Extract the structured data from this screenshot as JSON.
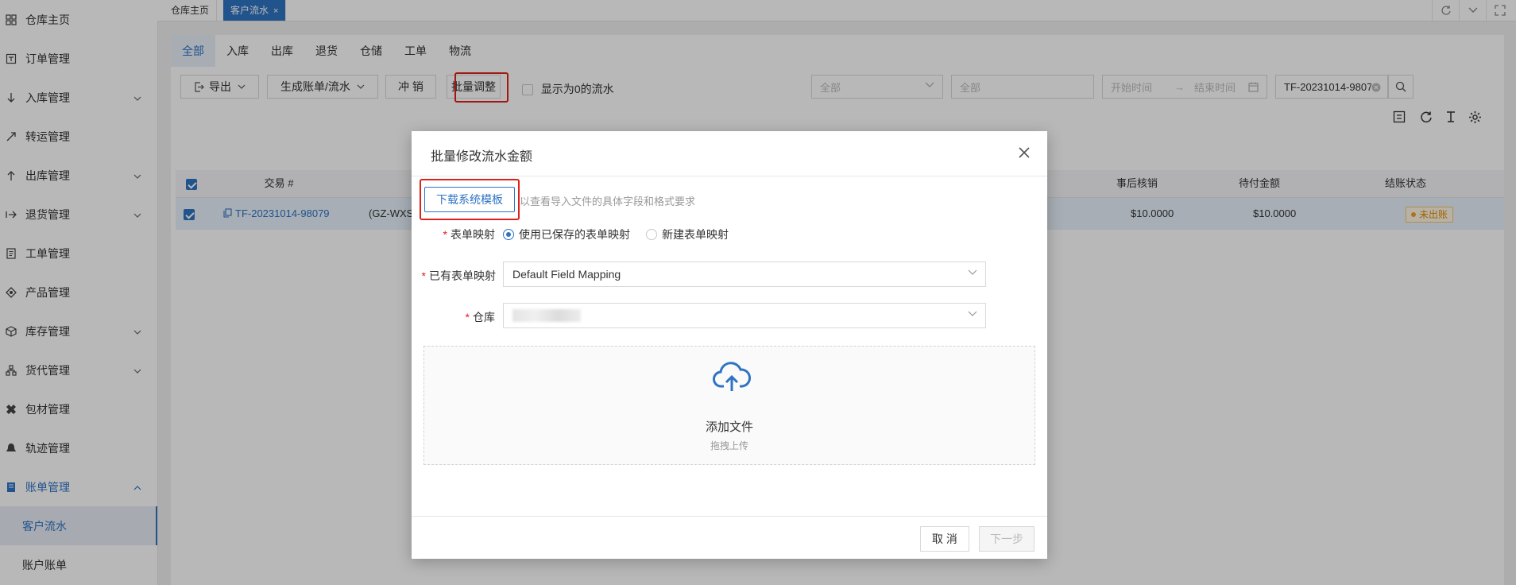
{
  "sidebar": {
    "items": [
      {
        "label": "仓库主页",
        "icon": "grid-icon",
        "chevron": false
      },
      {
        "label": "订单管理",
        "icon": "order-icon",
        "chevron": false
      },
      {
        "label": "入库管理",
        "icon": "inbound-icon",
        "chevron": true
      },
      {
        "label": "转运管理",
        "icon": "transfer-icon",
        "chevron": false
      },
      {
        "label": "出库管理",
        "icon": "outbound-icon",
        "chevron": true
      },
      {
        "label": "退货管理",
        "icon": "return-icon",
        "chevron": true
      },
      {
        "label": "工单管理",
        "icon": "ticket-icon",
        "chevron": false
      },
      {
        "label": "产品管理",
        "icon": "product-icon",
        "chevron": false
      },
      {
        "label": "库存管理",
        "icon": "inventory-icon",
        "chevron": true
      },
      {
        "label": "货代管理",
        "icon": "forwarder-icon",
        "chevron": true
      },
      {
        "label": "包材管理",
        "icon": "package-icon",
        "chevron": false
      },
      {
        "label": "轨迹管理",
        "icon": "track-icon",
        "chevron": false
      },
      {
        "label": "账单管理",
        "icon": "bill-icon",
        "chevron": true
      }
    ],
    "sub_items": [
      {
        "label": "客户流水"
      },
      {
        "label": "账户账单"
      }
    ]
  },
  "tabs": {
    "home": "仓库主页",
    "active": "客户流水",
    "close": "×"
  },
  "filter_tabs": [
    "全部",
    "入库",
    "出库",
    "退货",
    "仓储",
    "工单",
    "物流"
  ],
  "toolbar": {
    "export": "导出",
    "generate": "生成账单/流水",
    "writeoff": "冲 销",
    "batch_adjust": "批量调整",
    "show_zero": "显示为0的流水",
    "filter1_placeholder": "全部",
    "filter2_placeholder": "全部",
    "start_time": "开始时间",
    "range_arrow": "→",
    "end_time": "结束时间",
    "search_value": "TF-20231014-98079"
  },
  "table": {
    "headers": {
      "txn": "交易 #",
      "post": "事后核销",
      "pending": "待付金额",
      "status": "结账状态"
    },
    "row": {
      "txn": "TF-20231014-98079",
      "ref": "(GZ-WXS",
      "post": "$10.0000",
      "pending": "$10.0000",
      "status": "未出账"
    }
  },
  "modal": {
    "title": "批量修改流水金额",
    "download_btn": "下载系统模板",
    "hint": "以查看导入文件的具体字段和格式要求",
    "form_mapping_label": "表单映射",
    "radio_saved": "使用已保存的表单映射",
    "radio_new": "新建表单映射",
    "existing_mapping_label": "已有表单映射",
    "existing_mapping_value": "Default Field Mapping",
    "warehouse_label": "仓库",
    "required_mark": "*",
    "upload_title": "添加文件",
    "upload_sub": "拖拽上传",
    "cancel": "取 消",
    "next": "下一步"
  },
  "colors": {
    "accent": "#2f73c4",
    "highlight": "#e0201a"
  }
}
